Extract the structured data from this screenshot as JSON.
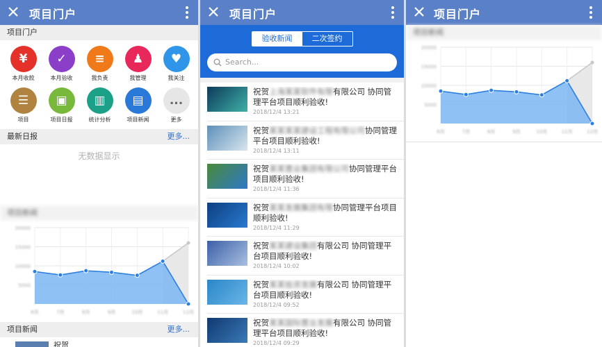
{
  "panel1": {
    "title": "项目门户",
    "portal_section": "项目门户",
    "icons": [
      {
        "label": "本月收款",
        "glyph": "¥",
        "color": "#e4322b",
        "icon": "yen-icon"
      },
      {
        "label": "本月验收",
        "glyph": "✓",
        "color": "#8b3fc9",
        "icon": "document-check-icon"
      },
      {
        "label": "我负责",
        "glyph": "≡",
        "color": "#f07a1a",
        "icon": "list-person-icon"
      },
      {
        "label": "我管理",
        "glyph": "♟",
        "color": "#e8285a",
        "icon": "manager-icon"
      },
      {
        "label": "我关注",
        "glyph": "♥",
        "color": "#2e95e8",
        "icon": "heart-icon"
      },
      {
        "label": "项目",
        "glyph": "☰",
        "color": "#b08440",
        "icon": "database-icon"
      },
      {
        "label": "项目日报",
        "glyph": "▣",
        "color": "#78b83a",
        "icon": "report-icon"
      },
      {
        "label": "统计分析",
        "glyph": "▥",
        "color": "#1ca088",
        "icon": "bar-chart-icon"
      },
      {
        "label": "项目新闻",
        "glyph": "▤",
        "color": "#2a78d8",
        "icon": "newspaper-icon"
      },
      {
        "label": "更多",
        "glyph": "...",
        "color": "#e6e6e6",
        "icon": "more-icon"
      }
    ],
    "daily_report": {
      "title": "最新日报",
      "more": "更多...",
      "empty": "无数据显示"
    },
    "chart_title": "项目新闻",
    "news_section": {
      "title": "项目新闻",
      "more": "更多...",
      "first_item_prefix": "祝贺"
    }
  },
  "panel2": {
    "tabs": [
      "验收新闻",
      "二次签约"
    ],
    "search_placeholder": "Search...",
    "news": [
      {
        "prefix": "祝贺",
        "company": "上海某某软件有限",
        "title_tail": "有限公司 协同管理平台项目顺利验收!",
        "date": "2018/12/4 13:21",
        "c1": "#0e3a5a",
        "c2": "#3fb0a8"
      },
      {
        "prefix": "祝贺",
        "company": "某某某某建设工程有限公司",
        "title_tail": "协同管理平台项目顺利验收!",
        "date": "2018/12/4 13:11",
        "c1": "#5d8fb8",
        "c2": "#d8e6f0"
      },
      {
        "prefix": "祝贺",
        "company": "某某置业集团有限公司",
        "title_tail": "协同管理平台项目顺利验收!",
        "date": "2018/12/4 11:36",
        "c1": "#4a8a3a",
        "c2": "#2e78c8"
      },
      {
        "prefix": "祝贺",
        "company": "某某发展集团有限",
        "title_tail": "协同管理平台项目顺利验收!",
        "date": "2018/12/4 11:29",
        "c1": "#0d3f80",
        "c2": "#2a7ad0"
      },
      {
        "prefix": "祝贺",
        "company": "某某建设集团",
        "title_tail": "有限公司 协同管理平台项目顺利验收!",
        "date": "2018/12/4 10:02",
        "c1": "#3c5fa8",
        "c2": "#a8c0e0"
      },
      {
        "prefix": "祝贺",
        "company": "某某投资发展",
        "title_tail": "有限公司 协同管理平台项目顺利验收!",
        "date": "2018/12/4 09:52",
        "c1": "#2a86c8",
        "c2": "#6ab6e8"
      },
      {
        "prefix": "祝贺",
        "company": "某某国际置业发展",
        "title_tail": "有限公司 协同管理平台项目顺利验收!",
        "date": "2018/12/4 09:29",
        "c1": "#103870",
        "c2": "#3a7ab8"
      }
    ]
  },
  "panel3": {
    "title": "项目门户"
  },
  "chart_data": {
    "type": "area",
    "x": [
      "6月",
      "7月",
      "8月",
      "9月",
      "10月",
      "11月",
      "12月"
    ],
    "series": [
      {
        "values": [
          8500,
          7600,
          8700,
          8300,
          7500,
          11200,
          0
        ],
        "color": "#4a98e8"
      },
      {
        "values": [
          null,
          null,
          null,
          null,
          null,
          11200,
          16000
        ],
        "color": "#d0d0d0"
      }
    ],
    "ylim": [
      0,
      20000
    ],
    "yticks": [
      5000,
      10000,
      15000,
      20000
    ],
    "grid": true
  },
  "colors": {
    "header": "#5a80c8",
    "accent": "#1c6bd8",
    "link": "#2a6fc9"
  }
}
